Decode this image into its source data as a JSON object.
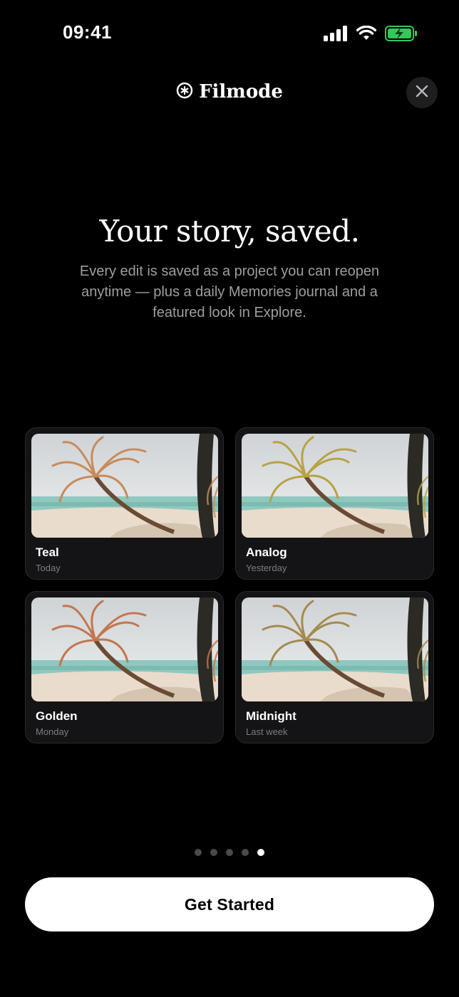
{
  "status_bar": {
    "time": "09:41"
  },
  "header": {
    "brand": "Filmode",
    "close_icon": "close-icon"
  },
  "hero": {
    "title": "Your story, saved.",
    "subtitle": "Every edit is saved as a project you can reopen anytime — plus a daily Memories journal and a featured look in Explore."
  },
  "projects": [
    {
      "title": "Teal",
      "date": "Today",
      "tint": "#c98a5a"
    },
    {
      "title": "Analog",
      "date": "Yesterday",
      "tint": "#b9a243"
    },
    {
      "title": "Golden",
      "date": "Monday",
      "tint": "#c2764e"
    },
    {
      "title": "Midnight",
      "date": "Last week",
      "tint": "#a58a4f"
    }
  ],
  "pagination": {
    "total": 5,
    "active_index": 4
  },
  "cta": {
    "label": "Get Started"
  },
  "colors": {
    "background": "#000000",
    "battery": "#34c759",
    "card": "#141416",
    "cta_bg": "#ffffff"
  }
}
